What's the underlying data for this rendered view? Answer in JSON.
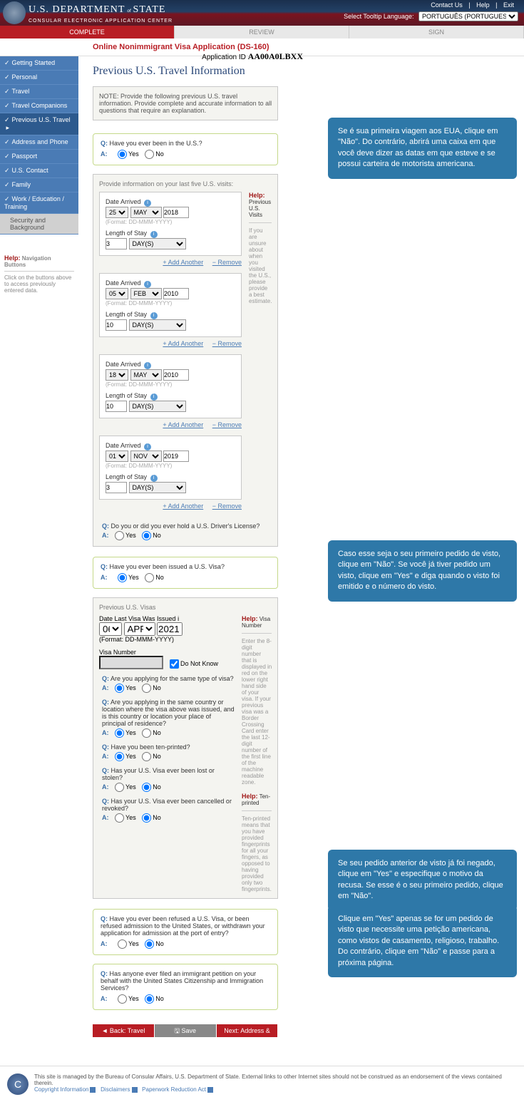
{
  "banner": {
    "topLinks": [
      "Contact Us",
      "Help",
      "Exit"
    ],
    "dept": "U.S. DEPARTMENT",
    "of": "of",
    "state": "STATE",
    "sub": "CONSULAR ELECTRONIC APPLICATION CENTER",
    "langLabel": "Select Tooltip Language:",
    "langValue": "PORTUGUÊS (PORTUGUESE)"
  },
  "tabs": {
    "complete": "COMPLETE",
    "review": "REVIEW",
    "sign": "SIGN"
  },
  "appRow": {
    "title": "Online Nonimmigrant Visa Application (DS-160)",
    "appIdLabel": "Application ID",
    "appId": "AA00A0LBXX"
  },
  "sidebar": {
    "items": [
      "Getting Started",
      "Personal",
      "Travel",
      "Travel Companions",
      "Previous U.S. Travel",
      "Address and Phone",
      "Passport",
      "U.S. Contact",
      "Family",
      "Work / Education / Training"
    ],
    "sub": "Security and Background",
    "helpTitle": "Help:",
    "helpLabel": "Navigation Buttons",
    "helpText": "Click on the buttons above to access previously entered data."
  },
  "pageTitle": "Previous U.S. Travel Information",
  "note": "NOTE: Provide the following previous U.S. travel information. Provide complete and accurate information to all questions that require an explanation.",
  "q1": {
    "q": "Have you ever been in the U.S.?",
    "yes": "Yes",
    "no": "No",
    "panelTitle": "Provide information on your last five U.S. visits:",
    "dateLabel": "Date Arrived",
    "fmt": "(Format: DD-MMM-YYYY)",
    "losLabel": "Length of Stay",
    "add": "Add Another",
    "remove": "Remove",
    "visits": [
      {
        "dd": "25",
        "mm": "MAY",
        "yy": "2018",
        "los": "3",
        "unit": "DAY(S)"
      },
      {
        "dd": "05",
        "mm": "FEB",
        "yy": "2010",
        "los": "10",
        "unit": "DAY(S)"
      },
      {
        "dd": "18",
        "mm": "MAY",
        "yy": "2010",
        "los": "10",
        "unit": "DAY(S)"
      },
      {
        "dd": "01",
        "mm": "NOV",
        "yy": "2019",
        "los": "3",
        "unit": "DAY(S)"
      }
    ],
    "helpTitle": "Help:",
    "helpLabel": "Previous U.S. Visits",
    "helpText": "If you are unsure about when you visited the U.S., please provide a best estimate.",
    "dlQ": "Do you or did you ever hold a U.S. Driver's License?"
  },
  "q2": {
    "q": "Have you ever been issued a U.S. Visa?",
    "panelTitle": "Previous U.S. Visas",
    "dateLabel": "Date Last Visa Was Issued",
    "dd": "06",
    "mm": "APR",
    "yy": "2021",
    "fmt": "(Format: DD-MMM-YYYY)",
    "visaNumLabel": "Visa Number",
    "dnk": "Do Not Know",
    "helpTitle": "Help:",
    "helpLabel1": "Visa Number",
    "helpText1": "Enter the 8-digit number that is displayed in red on the lower right hand side of your visa. If your previous visa was a Border Crossing Card enter the last 12-digit number of the first line of the machine readable zone.",
    "helpLabel2": "Ten-printed",
    "helpText2": "Ten-printed means that you have provided fingerprints for all your fingers, as opposed to having provided only two fingerprints.",
    "subQ": [
      "Are you applying for the same type of visa?",
      "Are you applying in the same country or location where the visa above was issued, and is this country or location your place of principal of residence?",
      "Have you been ten-printed?",
      "Has your U.S. Visa ever been lost or stolen?",
      "Has your U.S. Visa ever been cancelled or revoked?"
    ]
  },
  "q3": {
    "q": "Have you ever been refused a U.S. Visa, or been refused admission to the United States, or withdrawn your application for admission at the port of entry?"
  },
  "q4": {
    "q": "Has anyone ever filed an immigrant petition on your behalf with the United States Citizenship and Immigration Services?"
  },
  "nav": {
    "back": "◄ Back: Travel Companions",
    "save": "🖫 Save",
    "next": "Next: Address & Phone ►"
  },
  "callouts": {
    "c1": "Se é sua primeira viagem aos EUA, clique em \"Não\". Do contrário, abrirá uma caixa em que você deve dizer as datas em que esteve e se possui carteira de motorista americana.",
    "c2": "Caso esse seja o seu primeiro pedido de visto, clique em \"Não\". Se você já tiver pedido um visto, clique em \"Yes\" e diga quando o visto foi emitido e o número do visto.",
    "c3": "Se seu pedido anterior de visto já foi negado, clique em \"Yes\" e especifique o motivo da recusa. Se esse é o seu primeiro pedido, clique em \"Não\".",
    "c4": "Clique em \"Yes\" apenas se for um pedido de visto que necessite uma petição americana, como vistos de casamento, religioso, trabalho. Do contrário, clique em \"Não\" e passe para a próxima página."
  },
  "footer": {
    "text": "This site is managed by the Bureau of Consular Affairs, U.S. Department of State. External links to other Internet sites should not be construed as an endorsement of the views contained therein.",
    "l1": "Copyright Information",
    "l2": "Disclaimers",
    "l3": "Paperwork Reduction Act"
  },
  "common": {
    "Q": "Q:",
    "A": "A:",
    "yes": "Yes",
    "no": "No"
  }
}
